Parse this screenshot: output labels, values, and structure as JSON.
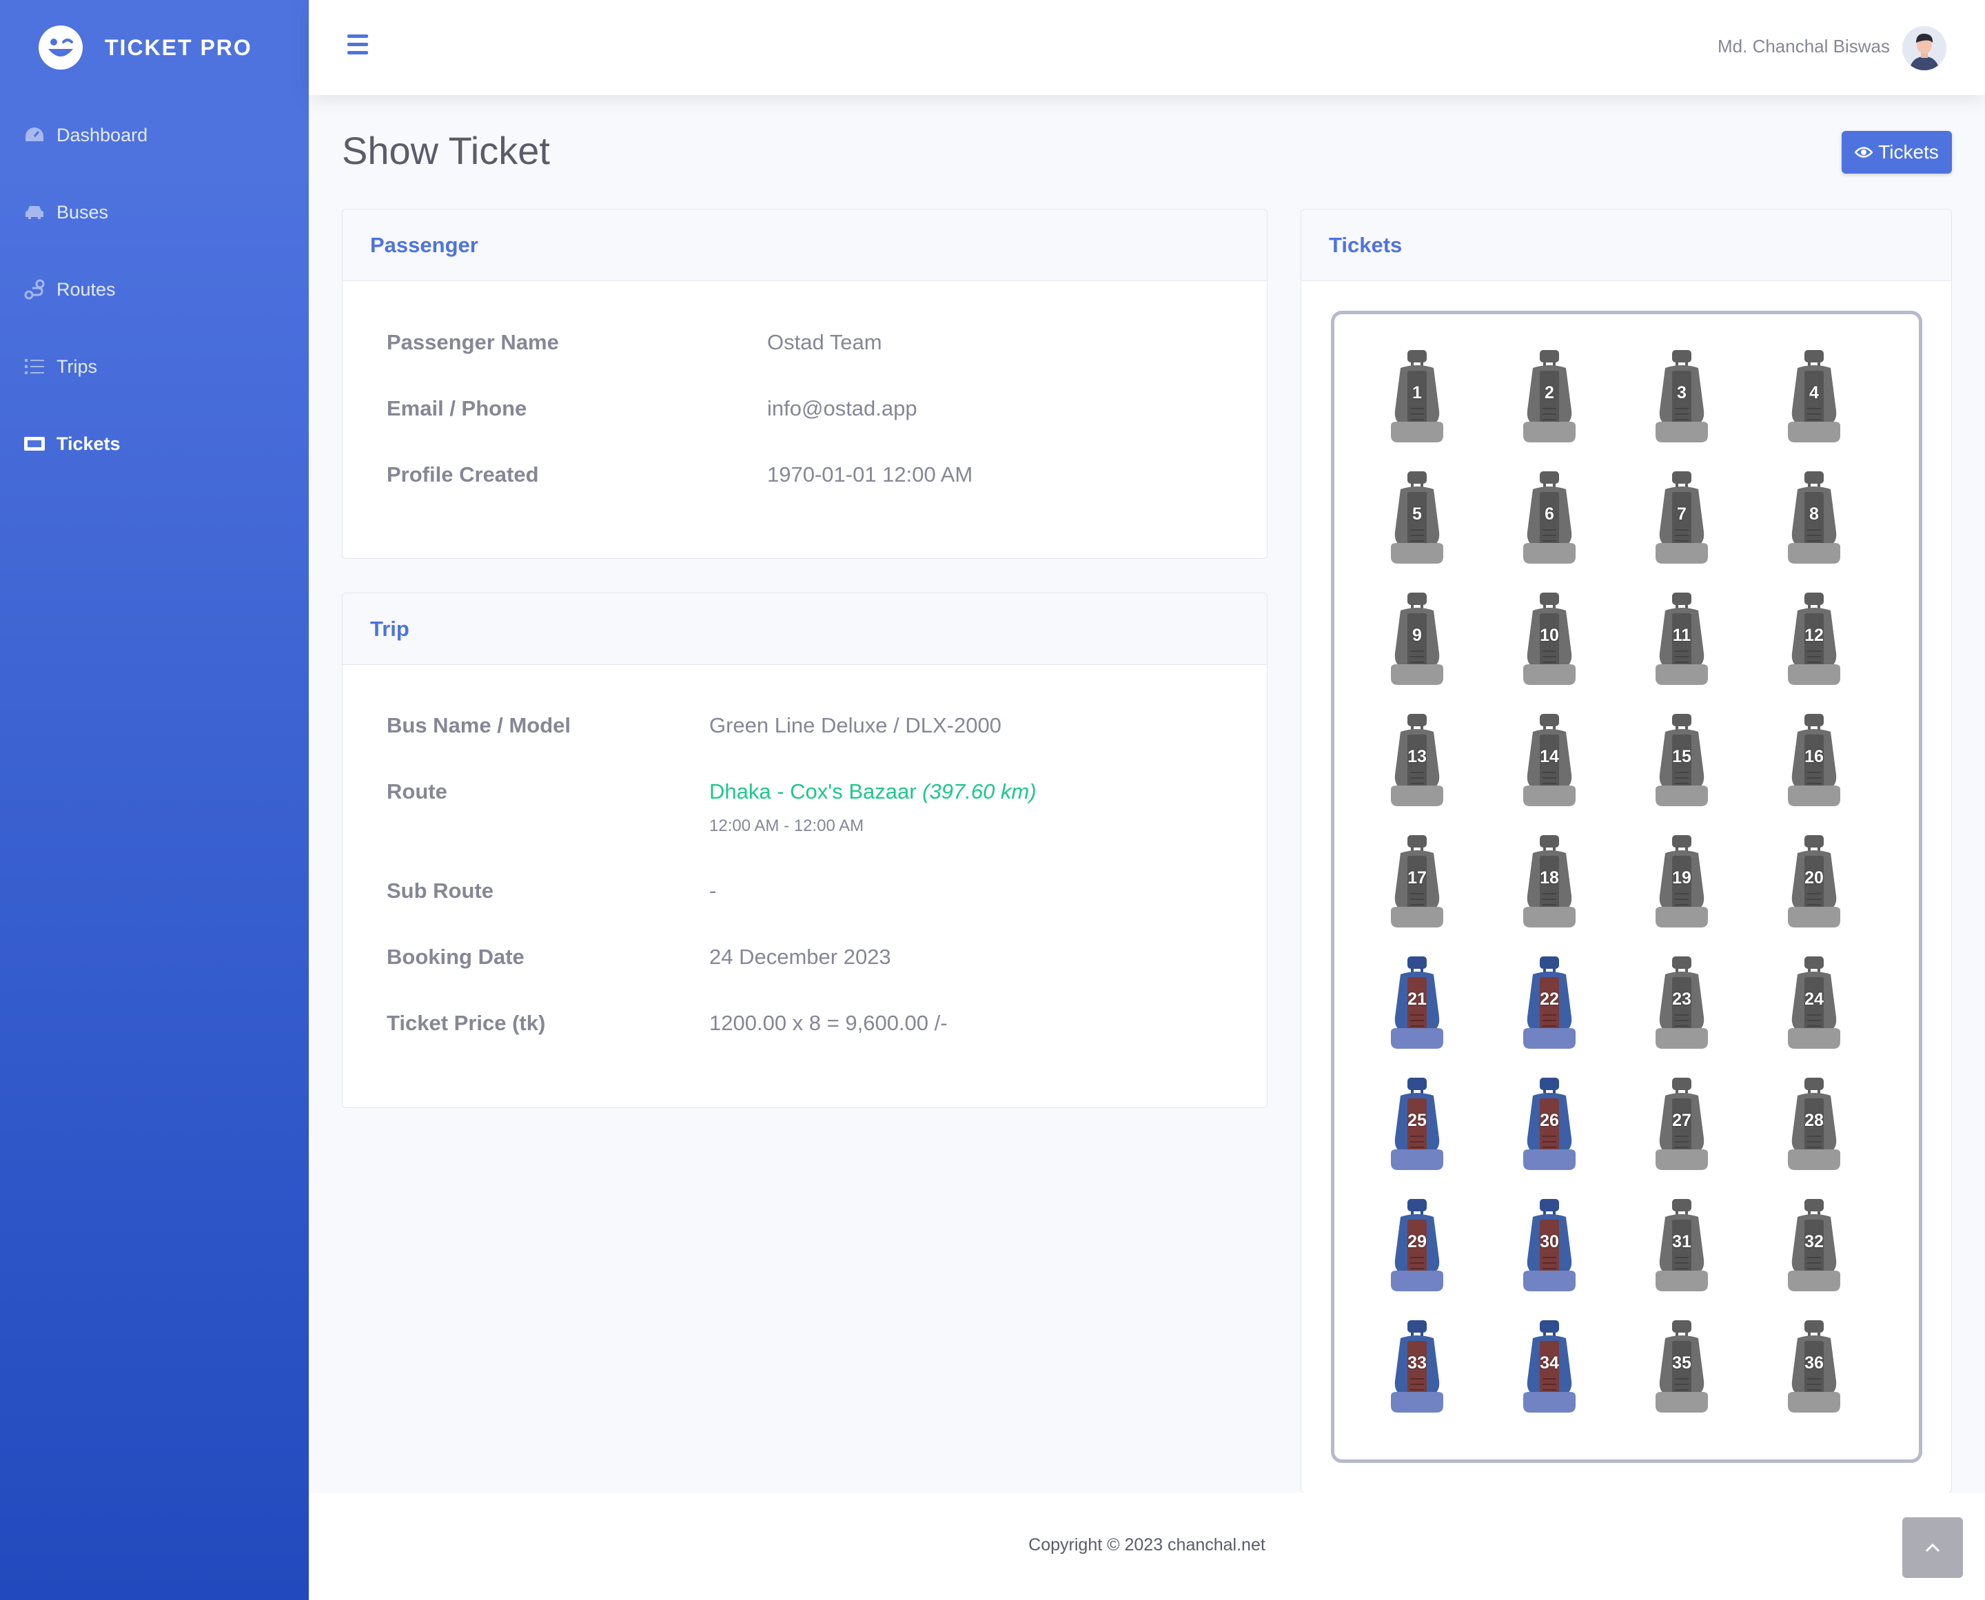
{
  "brand": {
    "name": "TICKET PRO"
  },
  "sidebar": {
    "items": [
      {
        "label": "Dashboard",
        "icon": "tachometer-icon"
      },
      {
        "label": "Buses",
        "icon": "car-icon"
      },
      {
        "label": "Routes",
        "icon": "route-icon"
      },
      {
        "label": "Trips",
        "icon": "list-icon"
      },
      {
        "label": "Tickets",
        "icon": "ticket-icon",
        "active": true
      }
    ]
  },
  "topbar": {
    "user_name": "Md. Chanchal Biswas"
  },
  "page": {
    "title": "Show Ticket",
    "tickets_button": "Tickets"
  },
  "passenger": {
    "title": "Passenger",
    "rows": [
      {
        "label": "Passenger Name",
        "value": "Ostad Team"
      },
      {
        "label": "Email / Phone",
        "value": "info@ostad.app"
      },
      {
        "label": "Profile Created",
        "value": "1970-01-01 12:00 AM"
      }
    ]
  },
  "trip": {
    "title": "Trip",
    "bus_label": "Bus Name / Model",
    "bus_value": "Green Line Deluxe / DLX-2000",
    "route_label": "Route",
    "route_value": "Dhaka - Cox's Bazaar",
    "route_distance": "(397.60 km)",
    "route_time": "12:00 AM - 12:00 AM",
    "subroute_label": "Sub Route",
    "subroute_value": "-",
    "booking_label": "Booking Date",
    "booking_value": "24 December 2023",
    "price_label": "Ticket Price (tk)",
    "price_value": "1200.00 x 8 = 9,600.00 /-"
  },
  "tickets_card": {
    "title": "Tickets",
    "seats": [
      {
        "n": "1",
        "booked": false
      },
      {
        "n": "2",
        "booked": false
      },
      {
        "n": "3",
        "booked": false
      },
      {
        "n": "4",
        "booked": false
      },
      {
        "n": "5",
        "booked": false
      },
      {
        "n": "6",
        "booked": false
      },
      {
        "n": "7",
        "booked": false
      },
      {
        "n": "8",
        "booked": false
      },
      {
        "n": "9",
        "booked": false
      },
      {
        "n": "10",
        "booked": false
      },
      {
        "n": "11",
        "booked": false
      },
      {
        "n": "12",
        "booked": false
      },
      {
        "n": "13",
        "booked": false
      },
      {
        "n": "14",
        "booked": false
      },
      {
        "n": "15",
        "booked": false
      },
      {
        "n": "16",
        "booked": false
      },
      {
        "n": "17",
        "booked": false
      },
      {
        "n": "18",
        "booked": false
      },
      {
        "n": "19",
        "booked": false
      },
      {
        "n": "20",
        "booked": false
      },
      {
        "n": "21",
        "booked": true
      },
      {
        "n": "22",
        "booked": true
      },
      {
        "n": "23",
        "booked": false
      },
      {
        "n": "24",
        "booked": false
      },
      {
        "n": "25",
        "booked": true
      },
      {
        "n": "26",
        "booked": true
      },
      {
        "n": "27",
        "booked": false
      },
      {
        "n": "28",
        "booked": false
      },
      {
        "n": "29",
        "booked": true
      },
      {
        "n": "30",
        "booked": true
      },
      {
        "n": "31",
        "booked": false
      },
      {
        "n": "32",
        "booked": false
      },
      {
        "n": "33",
        "booked": true
      },
      {
        "n": "34",
        "booked": true
      },
      {
        "n": "35",
        "booked": false
      },
      {
        "n": "36",
        "booked": false
      }
    ]
  },
  "footer": {
    "copyright": "Copyright © 2023 chanchal.net"
  },
  "colors": {
    "primary": "#4e73df",
    "booked_seat": "#3d5fa6",
    "available_seat": "#6e6e6e",
    "success": "#1cc88a"
  }
}
